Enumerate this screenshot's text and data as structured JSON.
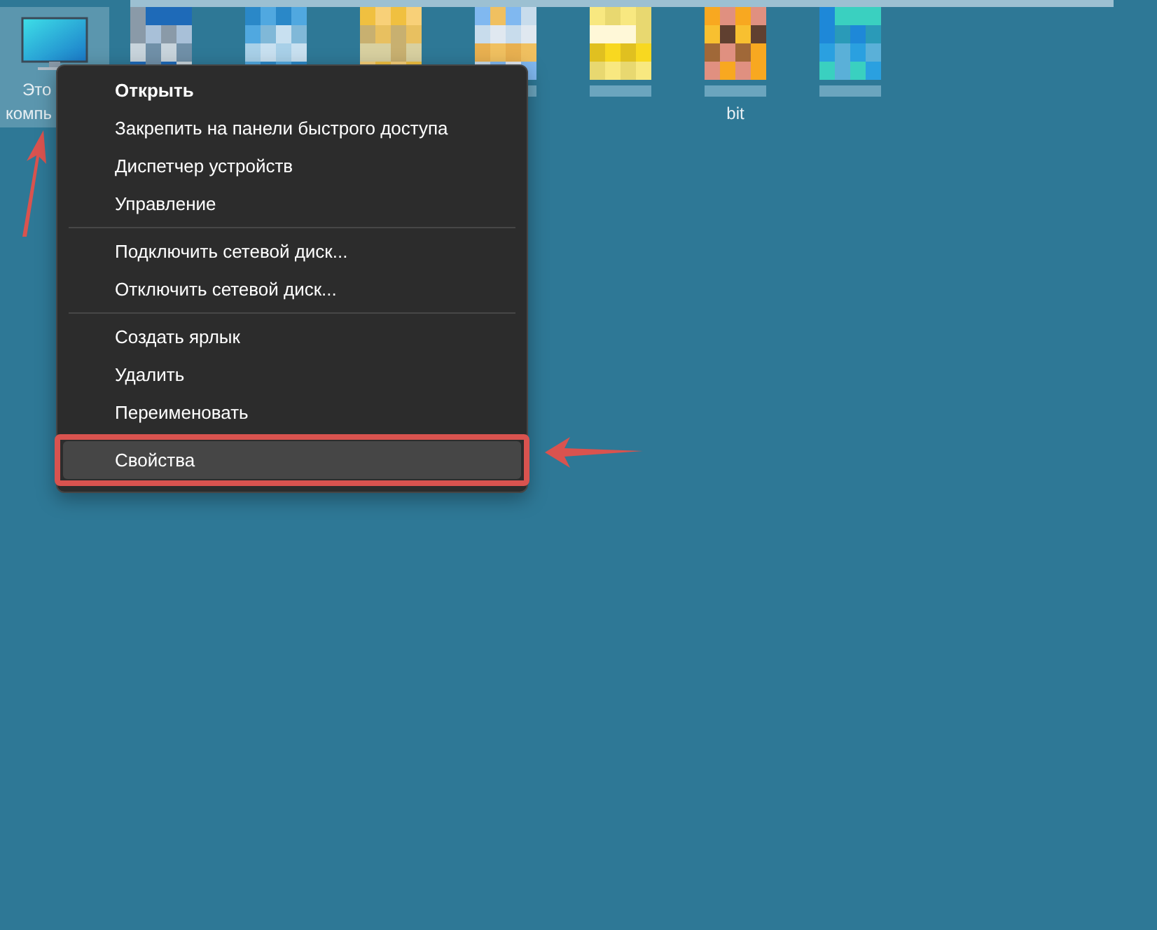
{
  "desktop": {
    "icons": [
      {
        "kind": "computer",
        "label_lines": [
          "Это",
          "компь"
        ],
        "selected": true,
        "annotated": true
      },
      {
        "kind": "blurred",
        "selected": false
      },
      {
        "kind": "blurred",
        "selected": false
      },
      {
        "kind": "blurred",
        "selected": false
      },
      {
        "kind": "blurred",
        "selected": false
      },
      {
        "kind": "blurred",
        "selected": false
      },
      {
        "kind": "blurred",
        "label_lines": [
          "bit"
        ],
        "selected": false
      },
      {
        "kind": "blurred",
        "selected": false
      }
    ]
  },
  "context_menu": {
    "items": [
      {
        "kind": "item",
        "label": "Открыть",
        "bold": true,
        "selected": false,
        "annotated": false
      },
      {
        "kind": "item",
        "label": "Закрепить на панели быстрого доступа",
        "bold": false,
        "selected": false,
        "annotated": false
      },
      {
        "kind": "item",
        "label": "Диспетчер устройств",
        "bold": false,
        "selected": false,
        "annotated": false
      },
      {
        "kind": "item",
        "label": "Управление",
        "bold": false,
        "selected": false,
        "annotated": false
      },
      {
        "kind": "separator"
      },
      {
        "kind": "item",
        "label": "Подключить сетевой диск...",
        "bold": false,
        "selected": false,
        "annotated": false
      },
      {
        "kind": "item",
        "label": "Отключить сетевой диск...",
        "bold": false,
        "selected": false,
        "annotated": false
      },
      {
        "kind": "separator"
      },
      {
        "kind": "item",
        "label": "Создать ярлык",
        "bold": false,
        "selected": false,
        "annotated": false
      },
      {
        "kind": "item",
        "label": "Удалить",
        "bold": false,
        "selected": false,
        "annotated": false
      },
      {
        "kind": "item",
        "label": "Переименовать",
        "bold": false,
        "selected": false,
        "annotated": false
      },
      {
        "kind": "item",
        "label": "Свойства",
        "bold": false,
        "selected": true,
        "annotated": true
      }
    ]
  }
}
